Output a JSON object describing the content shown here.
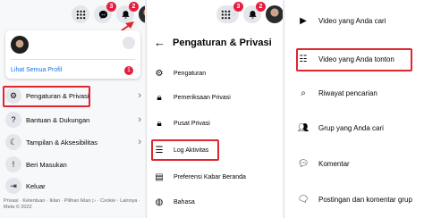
{
  "topbar": {
    "messenger_badge": "3",
    "notifications_badge": "2"
  },
  "panel1": {
    "see_all_profiles": "Lihat Semua Profil",
    "see_all_badge": "1",
    "menu": [
      {
        "label": "Pengaturan & Privasi",
        "icon": "gear-icon"
      },
      {
        "label": "Bantuan & Dukungan",
        "icon": "help-icon"
      },
      {
        "label": "Tampilan & Aksesibilitas",
        "icon": "moon-icon"
      },
      {
        "label": "Beri Masukan",
        "icon": "feedback-icon"
      },
      {
        "label": "Keluar",
        "icon": "logout-icon"
      }
    ],
    "footer": "Privasi · Ketentuan · Iklan · Pilihan Iklan ▷ · Cookie · Lainnya · Meta © 2022"
  },
  "panel2": {
    "title": "Pengaturan & Privasi",
    "items": [
      {
        "label": "Pengaturan",
        "icon": "gear-icon"
      },
      {
        "label": "Pemeriksaan Privasi",
        "icon": "lock-icon"
      },
      {
        "label": "Pusat Privasi",
        "icon": "lock-icon"
      },
      {
        "label": "Log Aktivitas",
        "icon": "list-icon"
      },
      {
        "label": "Preferensi Kabar Beranda",
        "icon": "feed-icon"
      },
      {
        "label": "Bahasa",
        "icon": "globe-icon"
      }
    ]
  },
  "panel3": {
    "items": [
      {
        "label": "Video yang Anda cari",
        "icon": "video-icon"
      },
      {
        "label": "Video yang Anda tonton",
        "icon": "video-list-icon"
      },
      {
        "label": "Riwayat pencarian",
        "icon": "search-icon"
      },
      {
        "label": "Grup yang Anda cari",
        "icon": "group-icon"
      },
      {
        "label": "Komentar",
        "icon": "comment-icon"
      },
      {
        "label": "Postingan dan komentar grup",
        "icon": "group-comment-icon"
      }
    ]
  },
  "colors": {
    "highlight": "#e0262f",
    "link": "#1b74e4",
    "badge": "#e41e3f"
  }
}
